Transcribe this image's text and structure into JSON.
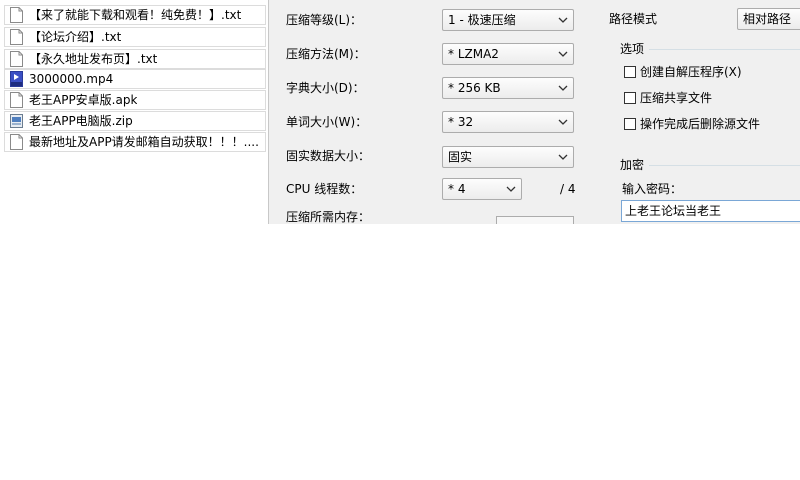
{
  "file_list": [
    {
      "name": "【来了就能下载和观看！纯免费！】.txt",
      "icon": "text-file-icon"
    },
    {
      "name": "【论坛介绍】.txt",
      "icon": "text-file-icon"
    },
    {
      "name": "【永久地址发布页】.txt",
      "icon": "text-file-icon"
    },
    {
      "name": "3000000.mp4",
      "icon": "mp4-file-icon"
    },
    {
      "name": "老王APP安卓版.apk",
      "icon": "generic-file-icon"
    },
    {
      "name": "老王APP电脑版.zip",
      "icon": "zip-file-icon"
    },
    {
      "name": "最新地址及APP请发邮箱自动获取！！！....",
      "icon": "text-file-icon"
    }
  ],
  "compression": {
    "level_label": "压缩等级(L)：",
    "level_value": "1 - 极速压缩",
    "method_label": "压缩方法(M)：",
    "method_value": "* LZMA2",
    "dict_label": "字典大小(D)：",
    "dict_value": "* 256 KB",
    "word_label": "单词大小(W)：",
    "word_value": "* 32",
    "solid_label": "固实数据大小：",
    "solid_value": "固实",
    "cpu_label": "CPU 线程数：",
    "cpu_value": "* 4",
    "cpu_total": "/ 4",
    "memory_label": "压缩所需内存："
  },
  "path_mode": {
    "label": "路径模式",
    "value": "相对路径"
  },
  "options": {
    "title": "选项",
    "sfx_label": "创建自解压程序(X)",
    "shared_label": "压缩共享文件",
    "delete_label": "操作完成后删除源文件"
  },
  "encryption": {
    "title": "加密",
    "password_label": "输入密码：",
    "password_value": "上老王论坛当老王"
  }
}
